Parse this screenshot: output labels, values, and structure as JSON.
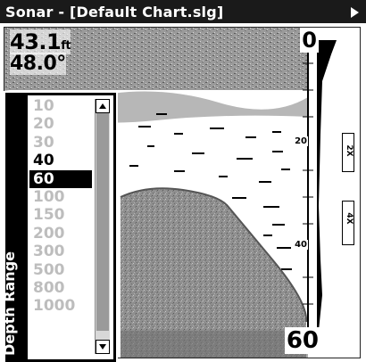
{
  "window": {
    "title": "Sonar - [Default Chart.slg]"
  },
  "readouts": {
    "depth_value": "43.1",
    "depth_unit": "ft",
    "temperature": "48.0°"
  },
  "scale": {
    "top": "0",
    "mid1": "20",
    "mid2": "40",
    "bottom": "60"
  },
  "zoom_bar": {
    "upper_label": "2X",
    "lower_label": "4X"
  },
  "depth_range_menu": {
    "label": "Depth Range",
    "selected": "60",
    "items": [
      {
        "label": "10",
        "enabled": false
      },
      {
        "label": "20",
        "enabled": false
      },
      {
        "label": "30",
        "enabled": false
      },
      {
        "label": "40",
        "enabled": true
      },
      {
        "label": "60",
        "enabled": true
      },
      {
        "label": "100",
        "enabled": false
      },
      {
        "label": "150",
        "enabled": false
      },
      {
        "label": "200",
        "enabled": false
      },
      {
        "label": "300",
        "enabled": false
      },
      {
        "label": "500",
        "enabled": false
      },
      {
        "label": "800",
        "enabled": false
      },
      {
        "label": "1000",
        "enabled": false
      }
    ]
  },
  "colors": {
    "title_bar": "#1a1a1a",
    "bottom_fill": "#9e9e9e",
    "selection": "#000000",
    "disabled_text": "#bdbdbd"
  }
}
